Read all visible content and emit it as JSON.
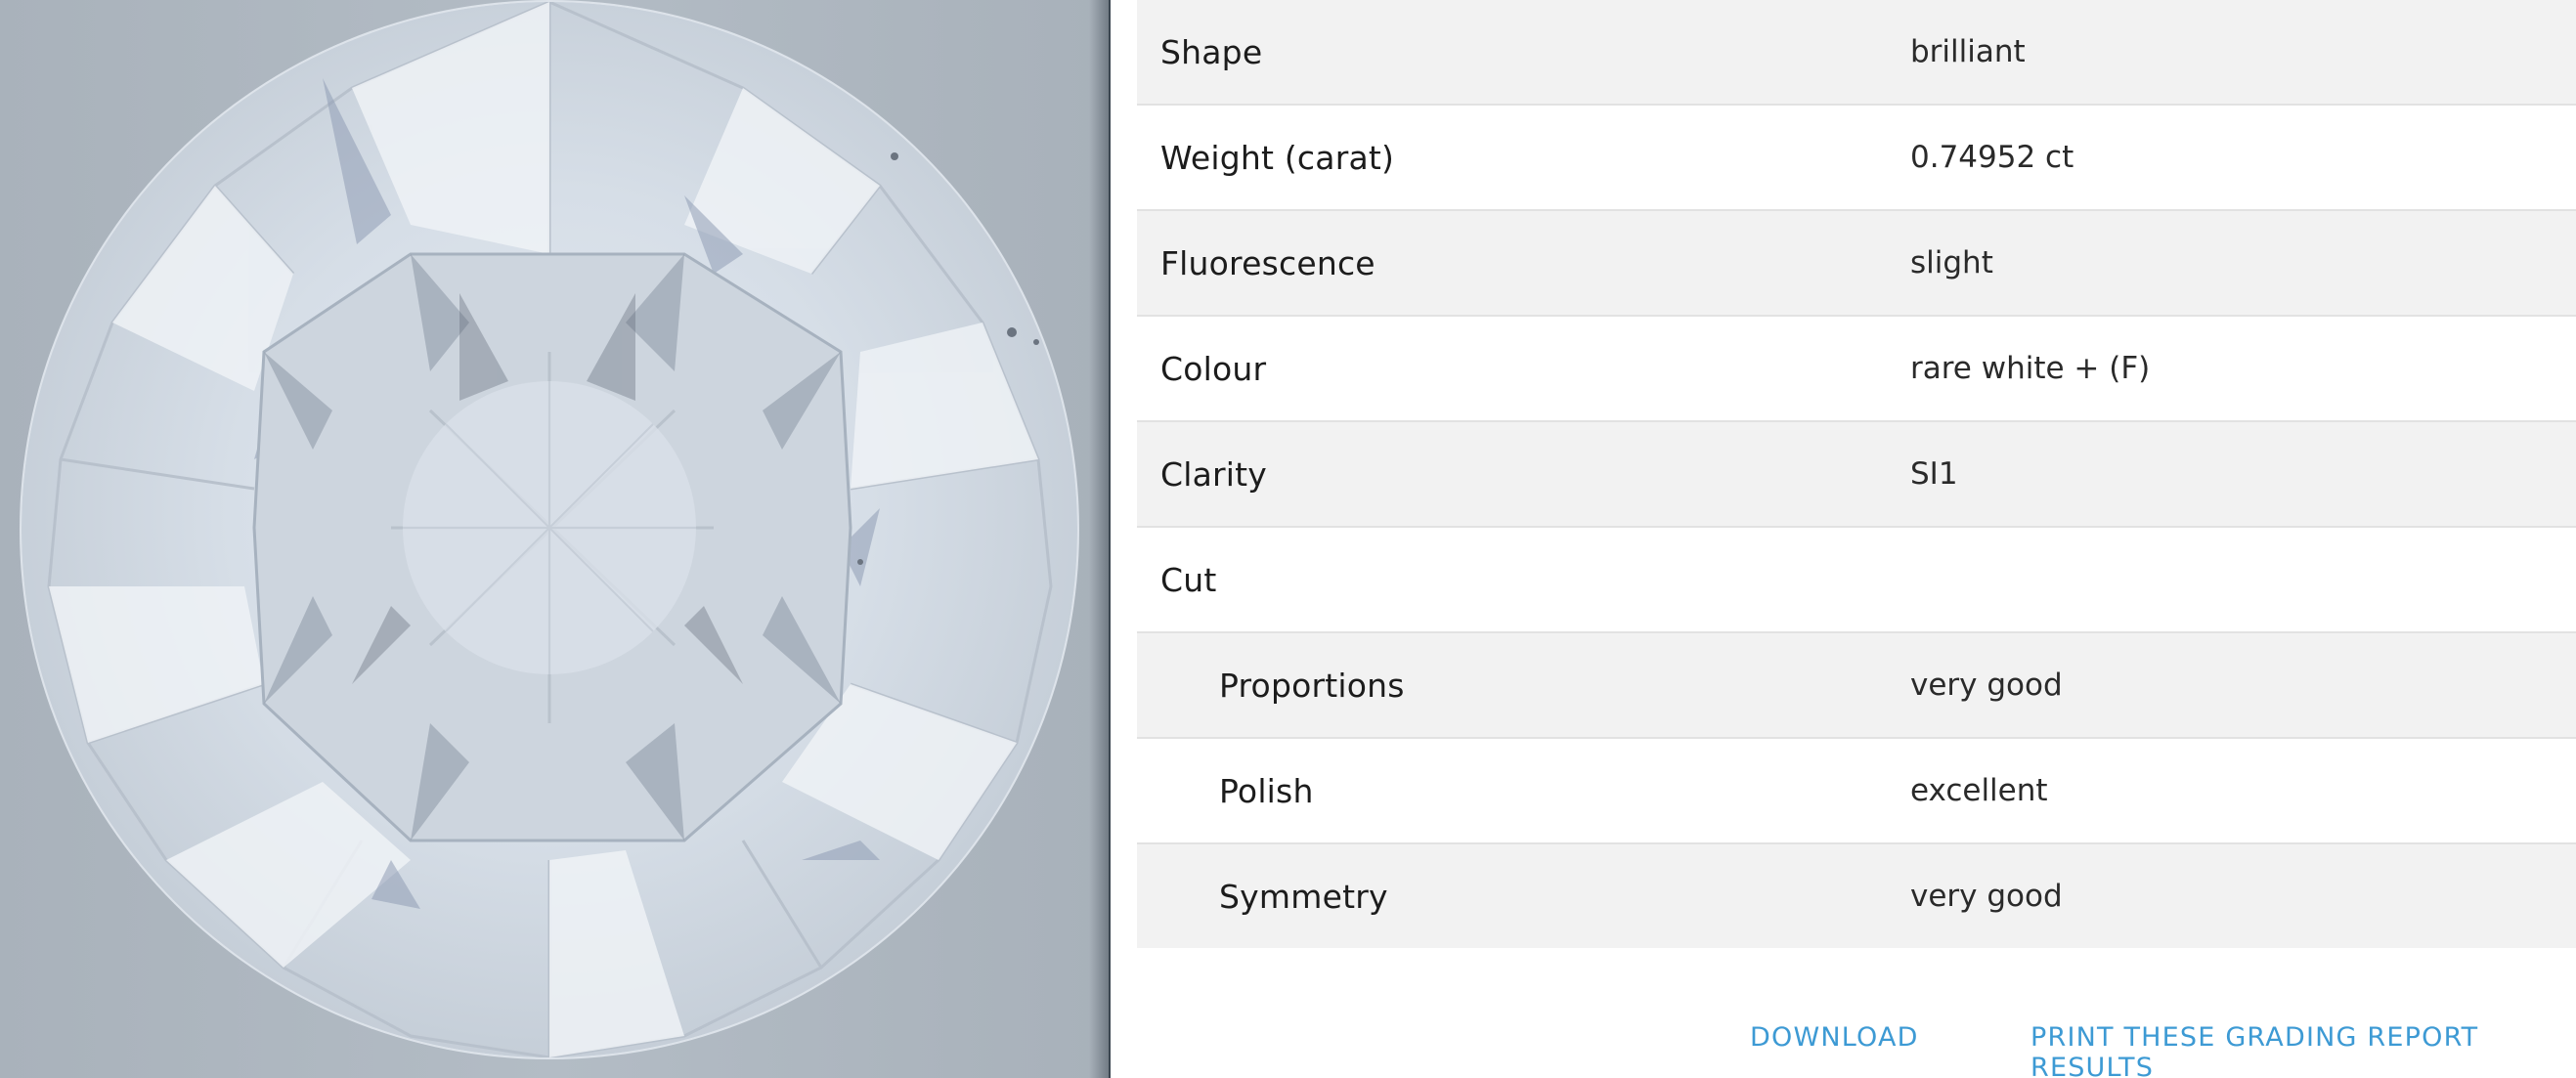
{
  "grading": {
    "rows": [
      {
        "label": "Shape",
        "value": "brilliant"
      },
      {
        "label": "Weight (carat)",
        "value": "0.74952 ct"
      },
      {
        "label": "Fluorescence",
        "value": "slight"
      },
      {
        "label": "Colour",
        "value": "rare white + (F)"
      },
      {
        "label": "Clarity",
        "value": "SI1"
      },
      {
        "label": "Cut",
        "value": ""
      },
      {
        "label": "Proportions",
        "value": "very good"
      },
      {
        "label": "Polish",
        "value": "excellent"
      },
      {
        "label": "Symmetry",
        "value": "very good"
      }
    ]
  },
  "actions": {
    "download_label": "DOWNLOAD",
    "print_label": "PRINT THESE GRADING REPORT RESULTS"
  },
  "colors": {
    "link": "#3d9ad4",
    "row_shade": "#f2f2f2",
    "photo_background": "#b0b9c2"
  }
}
